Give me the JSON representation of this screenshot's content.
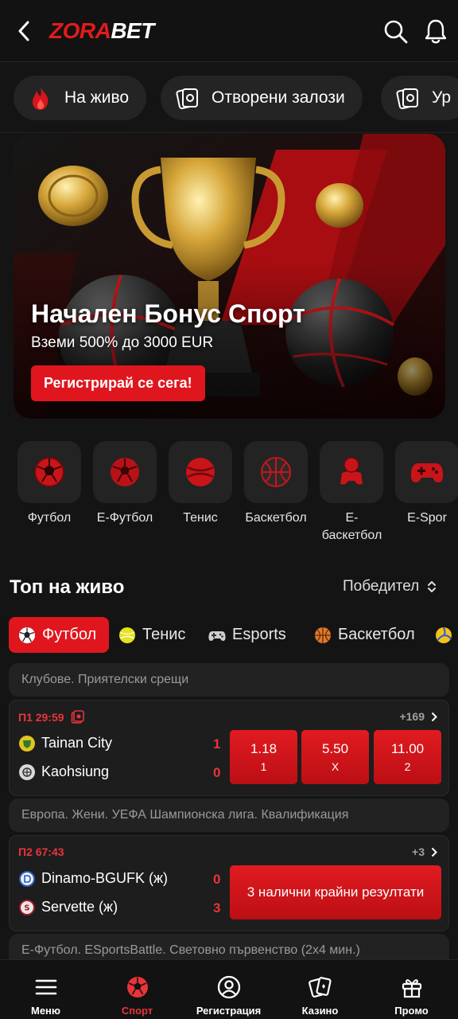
{
  "header": {
    "logo_part1": "ZORA",
    "logo_part2": "BET",
    "back_icon": "chevron-left-icon",
    "search_icon": "search-icon",
    "bell_icon": "bell-icon"
  },
  "quick_links": [
    {
      "label": "На живо",
      "icon": "fire-icon"
    },
    {
      "label": "Отворени залози",
      "icon": "open-bets-icon"
    },
    {
      "label": "Ур",
      "icon": "bets-icon"
    }
  ],
  "banner": {
    "title": "Начален Бонус Спорт",
    "subtitle": "Вземи 500% до 3000 EUR",
    "cta": "Регистрирай се сега!"
  },
  "sports": [
    {
      "label": "Футбол",
      "icon": "football-icon"
    },
    {
      "label": "Е-Футбол",
      "icon": "efootball-icon"
    },
    {
      "label": "Тенис",
      "icon": "tennis-icon"
    },
    {
      "label": "Баскетбол",
      "icon": "basketball-icon"
    },
    {
      "label": "Е-баскетбол",
      "icon": "ebasketball-icon"
    },
    {
      "label": "E-Spor",
      "icon": "gamepad-icon"
    }
  ],
  "top_live": {
    "title": "Топ на живо",
    "sort_label": "Победител"
  },
  "sport_tabs": [
    {
      "label": "Футбол",
      "icon": "football-icon"
    },
    {
      "label": "Тенис",
      "icon": "tennis-icon"
    },
    {
      "label": "Esports",
      "icon": "gamepad-icon"
    },
    {
      "label": "Баскетбол",
      "icon": "basketball-icon"
    },
    {
      "label": "",
      "icon": "volleyball-icon"
    }
  ],
  "events": [
    {
      "league": "Клубове. Приятелски срещи",
      "time": "П1 29:59",
      "more": "+169",
      "home": {
        "name": "Tainan City",
        "score": "1"
      },
      "away": {
        "name": "Kaohsiung",
        "score": "0"
      },
      "odds": [
        {
          "value": "1.18",
          "key": "1"
        },
        {
          "value": "5.50",
          "key": "X"
        },
        {
          "value": "11.00",
          "key": "2"
        }
      ]
    },
    {
      "league": "Европа. Жени. УЕФА Шампионска лига. Квалификация",
      "time": "П2 67:43",
      "more": "+3",
      "home": {
        "name": "Dinamo-BGUFK (ж)",
        "score": "0"
      },
      "away": {
        "name": "Servette (ж)",
        "score": "3"
      },
      "final_results": "3 налични крайни резултати"
    },
    {
      "league": "Е-Футбол. ESportsBattle. Световно първенство (2х4 мин.)"
    }
  ],
  "bottom_nav": [
    {
      "label": "Меню",
      "icon": "menu-icon"
    },
    {
      "label": "Спорт",
      "icon": "football-icon"
    },
    {
      "label": "Регистрация",
      "icon": "user-icon"
    },
    {
      "label": "Казино",
      "icon": "cards-icon"
    },
    {
      "label": "Промо",
      "icon": "gift-icon"
    }
  ],
  "colors": {
    "accent": "#e0161e",
    "background": "#141414",
    "card": "#1d1d1d"
  }
}
